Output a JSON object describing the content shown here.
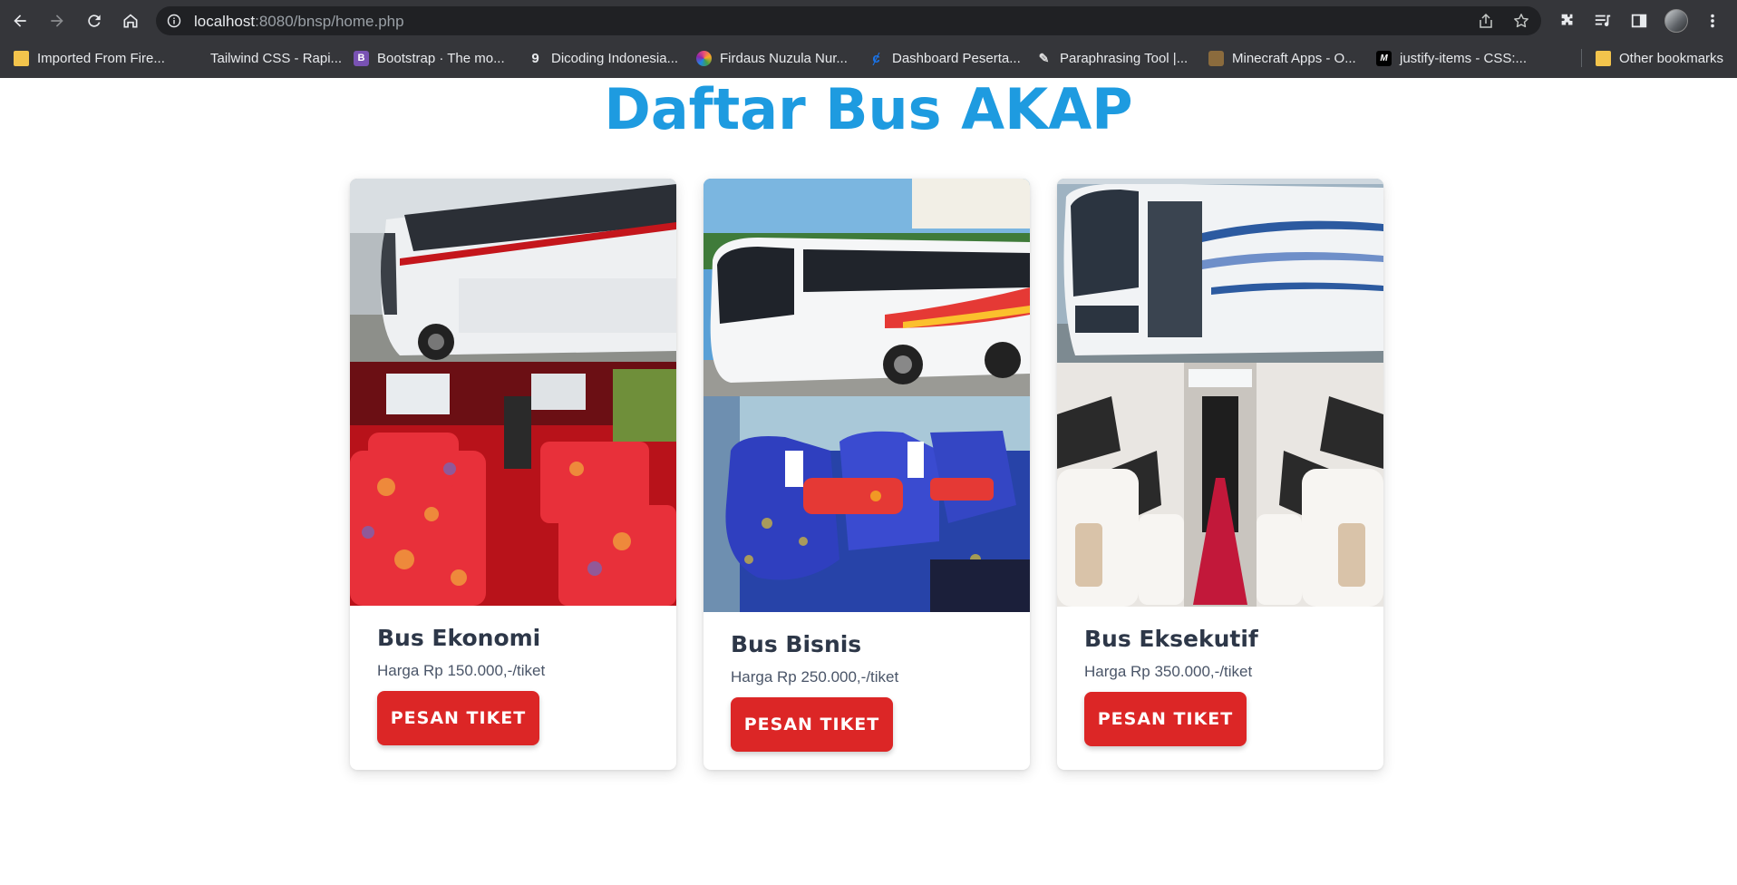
{
  "browser": {
    "url_host": "localhost",
    "url_rest": ":8080/bnsp/home.php",
    "bookmarks": [
      {
        "label": "Imported From Fire...",
        "icon": "folder-icon",
        "color": "#f3c44c"
      },
      {
        "label": "Tailwind CSS - Rapi...",
        "icon": "tailwind-icon",
        "color": "#38bdf8"
      },
      {
        "label": "Bootstrap · The mo...",
        "icon": "bootstrap-icon",
        "color": "#7952b3"
      },
      {
        "label": "Dicoding Indonesia...",
        "icon": "dicoding-icon",
        "color": "#ffffff"
      },
      {
        "label": "Firdaus Nuzula Nur...",
        "icon": "github-icon",
        "color": "#e94e77"
      },
      {
        "label": "Dashboard Peserta...",
        "icon": "dashboard-icon",
        "color": "#1a73e8"
      },
      {
        "label": "Paraphrasing Tool |...",
        "icon": "quill-icon",
        "color": "#dddddd"
      },
      {
        "label": "Minecraft Apps - O...",
        "icon": "minecraft-icon",
        "color": "#8b6b3d"
      },
      {
        "label": "justify-items - CSS:...",
        "icon": "mdn-icon",
        "color": "#000000"
      }
    ],
    "other_bookmarks": "Other bookmarks"
  },
  "page": {
    "title": "Daftar Bus AKAP"
  },
  "cards": [
    {
      "name": "Bus Ekonomi",
      "price": "Harga Rp 150.000,-/tiket",
      "button": "PESAN TIKET"
    },
    {
      "name": "Bus Bisnis",
      "price": "Harga Rp 250.000,-/tiket",
      "button": "PESAN TIKET"
    },
    {
      "name": "Bus Eksekutif",
      "price": "Harga Rp 350.000,-/tiket",
      "button": "PESAN TIKET"
    }
  ]
}
